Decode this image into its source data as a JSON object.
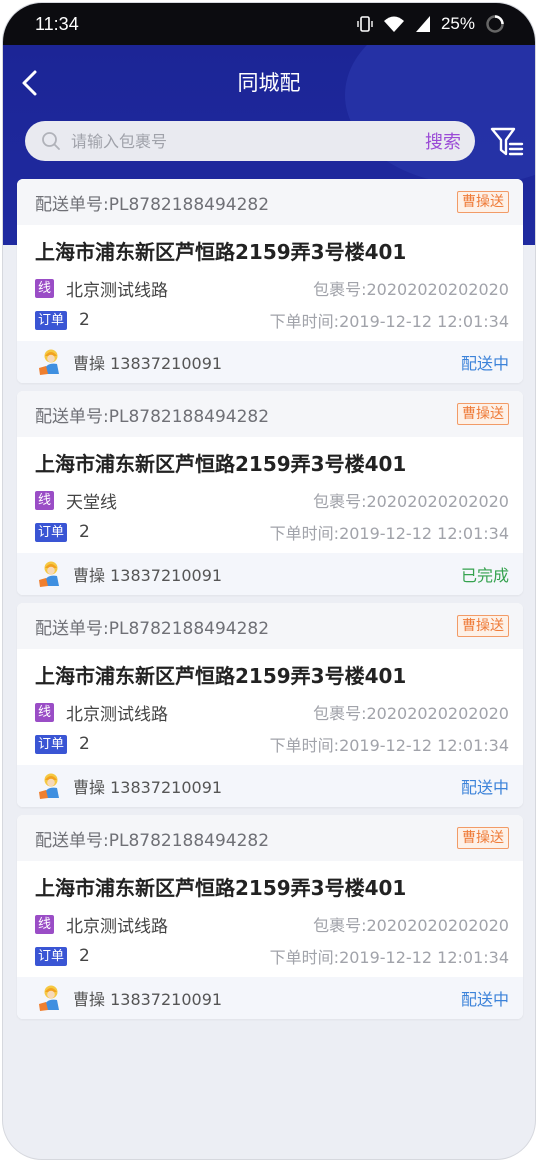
{
  "status_bar": {
    "time": "11:34",
    "battery": "25%"
  },
  "header": {
    "title": "同城配"
  },
  "search": {
    "placeholder": "请输入包裹号",
    "button": "搜索"
  },
  "colors": {
    "primary": "#1f2aa0",
    "accent_purple": "#9b4bd6",
    "orange": "#ef7d3b",
    "blue_status": "#3b82d9",
    "green_status": "#35a24e"
  },
  "orders": [
    {
      "delivery_no": "配送单号:PL8782188494282",
      "tag": "曹操送",
      "address": "上海市浦东新区芦恒路2159弄3号楼401",
      "line_badge": "线",
      "line_name": "北京测试线路",
      "package_no": "包裹号:20202020202020",
      "order_badge": "订单",
      "order_count": "2",
      "order_time": "下单时间:2019-12-12 12:01:34",
      "courier": "曹操 13837210091",
      "status": "配送中",
      "status_color": "#3b82d9"
    },
    {
      "delivery_no": "配送单号:PL8782188494282",
      "tag": "曹操送",
      "address": "上海市浦东新区芦恒路2159弄3号楼401",
      "line_badge": "线",
      "line_name": "天堂线",
      "package_no": "包裹号:20202020202020",
      "order_badge": "订单",
      "order_count": "2",
      "order_time": "下单时间:2019-12-12 12:01:34",
      "courier": "曹操 13837210091",
      "status": "已完成",
      "status_color": "#35a24e"
    },
    {
      "delivery_no": "配送单号:PL8782188494282",
      "tag": "曹操送",
      "address": "上海市浦东新区芦恒路2159弄3号楼401",
      "line_badge": "线",
      "line_name": "北京测试线路",
      "package_no": "包裹号:20202020202020",
      "order_badge": "订单",
      "order_count": "2",
      "order_time": "下单时间:2019-12-12 12:01:34",
      "courier": "曹操 13837210091",
      "status": "配送中",
      "status_color": "#3b82d9"
    },
    {
      "delivery_no": "配送单号:PL8782188494282",
      "tag": "曹操送",
      "address": "上海市浦东新区芦恒路2159弄3号楼401",
      "line_badge": "线",
      "line_name": "北京测试线路",
      "package_no": "包裹号:20202020202020",
      "order_badge": "订单",
      "order_count": "2",
      "order_time": "下单时间:2019-12-12 12:01:34",
      "courier": "曹操 13837210091",
      "status": "配送中",
      "status_color": "#3b82d9"
    }
  ]
}
